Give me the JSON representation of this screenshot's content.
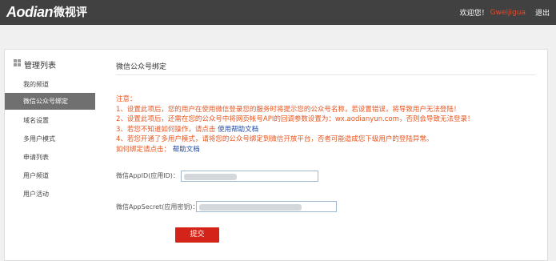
{
  "header": {
    "logo_en": "Aodian",
    "logo_cn": "微视评",
    "welcome": "欢迎您！",
    "username": "Gweijigua",
    "logout": "退出"
  },
  "sidebar": {
    "title": "管理列表",
    "items": [
      {
        "label": "我的频道",
        "active": false
      },
      {
        "label": "微信公众号绑定",
        "active": true
      },
      {
        "label": "域名设置",
        "active": false
      },
      {
        "label": "多用户模式",
        "active": false
      },
      {
        "label": "申请列表",
        "active": false
      },
      {
        "label": "用户频道",
        "active": false
      },
      {
        "label": "用户活动",
        "active": false
      }
    ]
  },
  "main": {
    "title": "微信公众号绑定",
    "notes": {
      "heading": "注意：",
      "line1": "1、设置此项后，您的用户在使用微信登录您的服务时将提示您的公众号名称，若设置错误，将导致用户无法登陆！",
      "line2": "2、设置此项后，还需在您的公众号中将网页帐号API的回调参数设置为：wx.aodianyun.com，否则会导致无法登录！",
      "line3_prefix": "3、若您不知道如何操作，请点击",
      "line3_link": "使用帮助文档",
      "line4": "4、若您开通了多用户模式，请将您的公众号绑定到微信开放平台，否者可能造成您下级用户的登陆异常。",
      "howto_prefix": "如何绑定请点击：",
      "howto_link": "帮助文档"
    },
    "appid_label": "微信AppID(应用ID)：",
    "appsecret_label": "微信AppSecret(应用密钥)：",
    "submit": "提交"
  },
  "colors": {
    "topbar": "#414141",
    "accent_red": "#d42318",
    "note_orange": "#e8551f",
    "link_blue": "#1f4aa8",
    "active_sidebar": "#707070"
  }
}
